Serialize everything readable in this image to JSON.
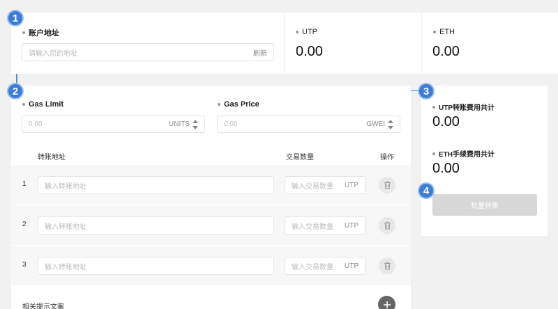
{
  "account": {
    "label": "账户地址",
    "placeholder": "请输入您的地址",
    "refresh": "刷新"
  },
  "balances": {
    "utp_label": "UTP",
    "utp_value": "0.00",
    "eth_label": "ETH",
    "eth_value": "0.00"
  },
  "gas": {
    "limit_label": "Gas Limit",
    "limit_placeholder": "0.00",
    "limit_unit": "UNITS",
    "price_label": "Gas Price",
    "price_placeholder": "0.00",
    "price_unit": "GWEI"
  },
  "table": {
    "col_address": "转账地址",
    "col_amount": "交易数量",
    "col_action": "操作",
    "rows": [
      {
        "index": "1",
        "address_placeholder": "输入转账地址",
        "amount_placeholder": "输入交易数量",
        "unit": "UTP"
      },
      {
        "index": "2",
        "address_placeholder": "输入转账地址",
        "amount_placeholder": "输入交易数量",
        "unit": "UTP"
      },
      {
        "index": "3",
        "address_placeholder": "输入转账地址",
        "amount_placeholder": "输入交易数量",
        "unit": "UTP"
      }
    ],
    "hint": "相关提示文案"
  },
  "fees": {
    "utp_label": "UTP转账费用共计",
    "utp_value": "0.00",
    "eth_label": "ETH手续费用共计",
    "eth_value": "0.00",
    "batch_button": "批量转账"
  },
  "markers": [
    "1",
    "2",
    "3",
    "4"
  ],
  "colors": {
    "marker": "#3c7bd6",
    "button_disabled": "#d7d7d7",
    "background": "#f1f1f1"
  }
}
